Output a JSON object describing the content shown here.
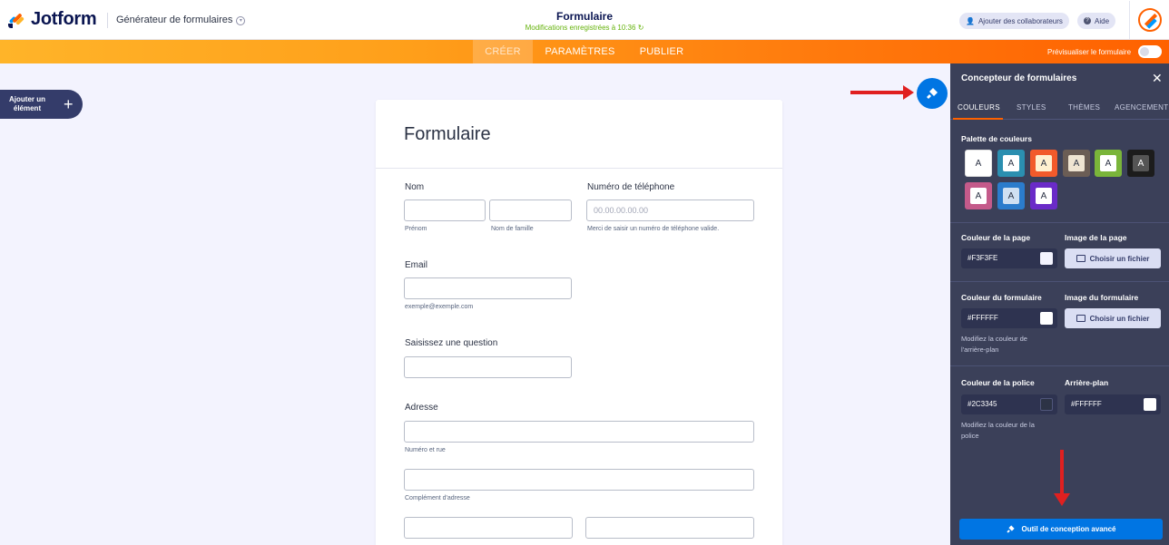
{
  "header": {
    "brand": "Jotform",
    "builder": "Générateur de formulaires",
    "form_title": "Formulaire",
    "save_status": "Modifications enregistrées à 10:36",
    "add_collaborators": "Ajouter des collaborateurs",
    "help": "Aide"
  },
  "nav": {
    "tabs": [
      "CRÉER",
      "PARAMÈTRES",
      "PUBLIER"
    ],
    "active": "CRÉER",
    "preview_label": "Prévisualiser le formulaire"
  },
  "sidebar": {
    "add_element": "Ajouter un élément"
  },
  "form": {
    "title": "Formulaire",
    "name_label": "Nom",
    "first_name_sub": "Prénom",
    "last_name_sub": "Nom de famille",
    "phone_label": "Numéro de téléphone",
    "phone_placeholder": "00.00.00.00.00",
    "phone_sub": "Merci de saisir un numéro de téléphone valide.",
    "email_label": "Email",
    "email_sub": "exemple@exemple.com",
    "question_label": "Saisissez une question",
    "address_label": "Adresse",
    "street_sub": "Numéro et rue",
    "complement_sub": "Complément d'adresse"
  },
  "panel": {
    "title": "Concepteur de formulaires",
    "tabs": [
      "COULEURS",
      "STYLES",
      "THÈMES",
      "AGENCEMENT"
    ],
    "active_tab": "COULEURS",
    "palette_title": "Palette de couleurs",
    "swatch_letter": "A",
    "swatches": [
      {
        "bg": "#ffffff",
        "inner": "#ffffff",
        "text": "#2c3345",
        "border": "#e0e0e0"
      },
      {
        "bg": "#2b8fb0",
        "inner": "#ffffff",
        "text": "#2c3345",
        "border": "#2b8fb0"
      },
      {
        "bg": "#f25a2b",
        "inner": "#fff0d0",
        "text": "#2c3345",
        "border": "#f25a2b"
      },
      {
        "bg": "#6b5d55",
        "inner": "#efe4d2",
        "text": "#2c3345",
        "border": "#6b5d55"
      },
      {
        "bg": "#7ab53a",
        "inner": "#ffffff",
        "text": "#2c3345",
        "border": "#7ab53a"
      },
      {
        "bg": "#1c1c1c",
        "inner": "#555555",
        "text": "#ffffff",
        "border": "#1c1c1c"
      },
      {
        "bg": "#c45a8a",
        "inner": "#ffffff",
        "text": "#2c3345",
        "border": "#c45a8a"
      },
      {
        "bg": "#2b7ccc",
        "inner": "#cfe0f2",
        "text": "#2c3345",
        "border": "#2b7ccc"
      },
      {
        "bg": "#6a2bc8",
        "inner": "#ffffff",
        "text": "#2c3345",
        "border": "#6a2bc8"
      }
    ],
    "page_color_label": "Couleur de la page",
    "page_color": "#F3F3FE",
    "page_image_label": "Image de la page",
    "form_color_label": "Couleur du formulaire",
    "form_color": "#FFFFFF",
    "form_color_hint": "Modifiez la couleur de l'arrière-plan",
    "form_image_label": "Image du formulaire",
    "choose_file": "Choisir un fichier",
    "font_color_label": "Couleur de la police",
    "font_color": "#2C3345",
    "font_color_hint": "Modifiez la couleur de la police",
    "background_label": "Arrière-plan",
    "background_color": "#FFFFFF",
    "advanced_button": "Outil de conception avancé"
  },
  "colors": {
    "accent_orange": "#ff6100",
    "accent_blue": "#0075e3",
    "annotation_red": "#e02020"
  }
}
